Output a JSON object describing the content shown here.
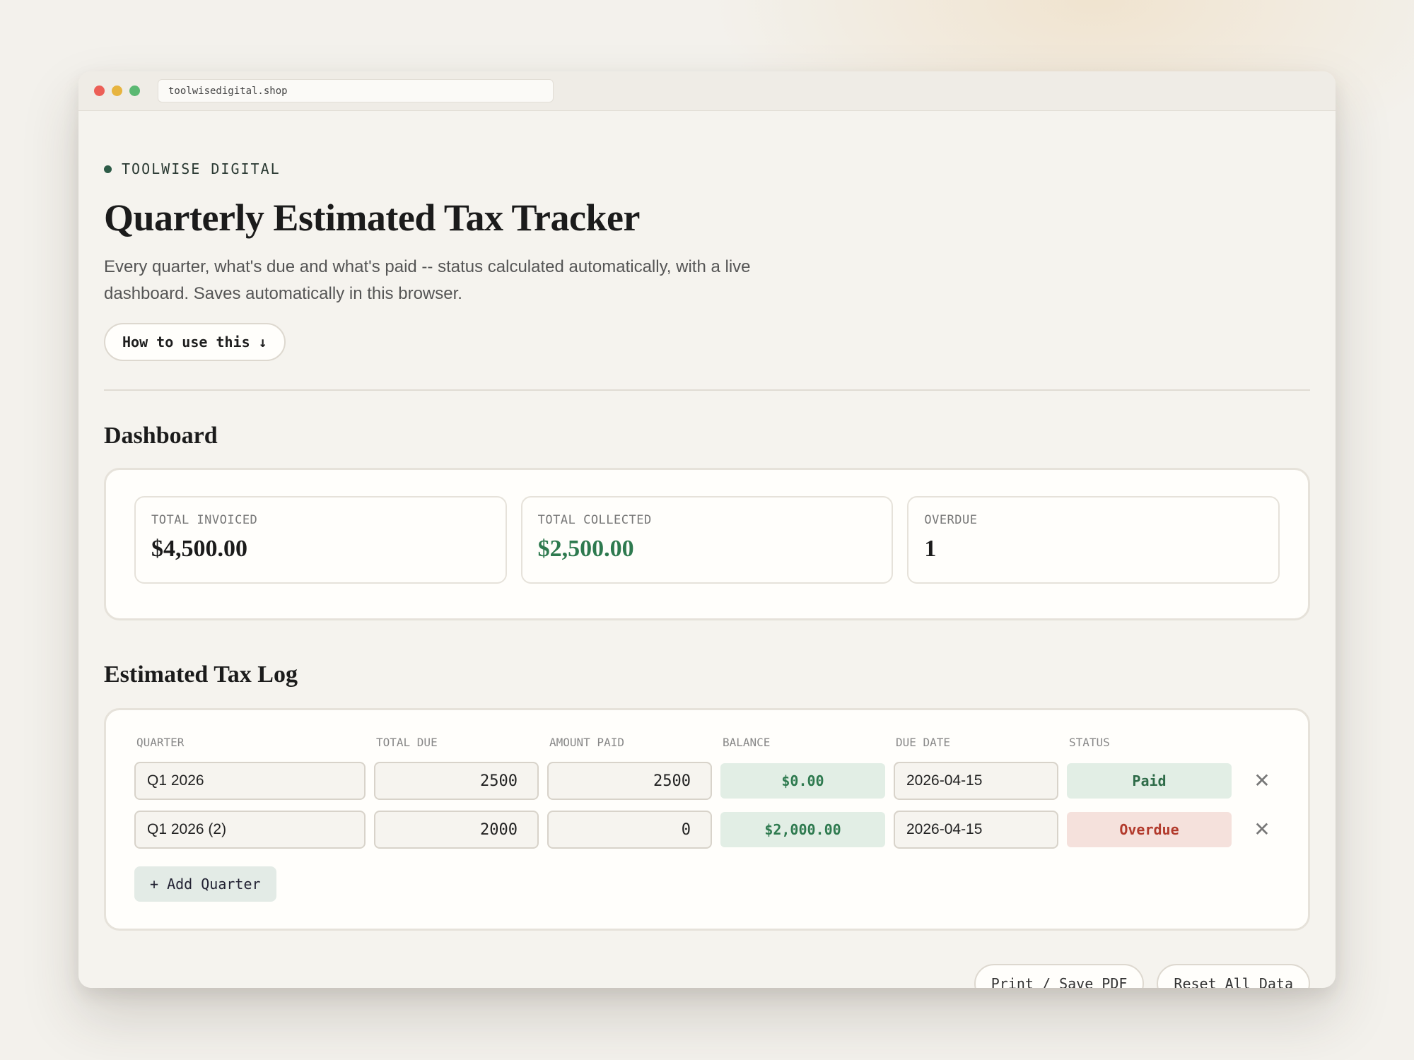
{
  "browser": {
    "url": "toolwisedigital.shop"
  },
  "brand": {
    "name": "TOOLWISE DIGITAL"
  },
  "page": {
    "title": "Quarterly Estimated Tax Tracker",
    "subtitle": "Every quarter, what's due and what's paid -- status calculated automatically, with a live dashboard. Saves automatically in this browser.",
    "how_to_label": "How to use this ↓"
  },
  "dashboard": {
    "title": "Dashboard",
    "stats": [
      {
        "label": "TOTAL INVOICED",
        "value": "$4,500.00"
      },
      {
        "label": "TOTAL COLLECTED",
        "value": "$2,500.00"
      },
      {
        "label": "OVERDUE",
        "value": "1"
      }
    ]
  },
  "log": {
    "title": "Estimated Tax Log",
    "columns": [
      "QUARTER",
      "TOTAL DUE",
      "AMOUNT PAID",
      "BALANCE",
      "DUE DATE",
      "STATUS"
    ],
    "rows": [
      {
        "quarter": "Q1 2026",
        "total_due": "2500",
        "amount_paid": "2500",
        "balance": "$0.00",
        "due_date": "2026-04-15",
        "status": "Paid"
      },
      {
        "quarter": "Q1 2026 (2)",
        "total_due": "2000",
        "amount_paid": "0",
        "balance": "$2,000.00",
        "due_date": "2026-04-15",
        "status": "Overdue"
      }
    ],
    "delete_glyph": "✕",
    "add_label": "+ Add Quarter"
  },
  "footer": {
    "print_label": "Print / Save PDF",
    "reset_label": "Reset All Data"
  },
  "colors": {
    "accent_green": "#2e7a4f",
    "overdue_red": "#b23a2c",
    "background": "#f3f1ec"
  }
}
